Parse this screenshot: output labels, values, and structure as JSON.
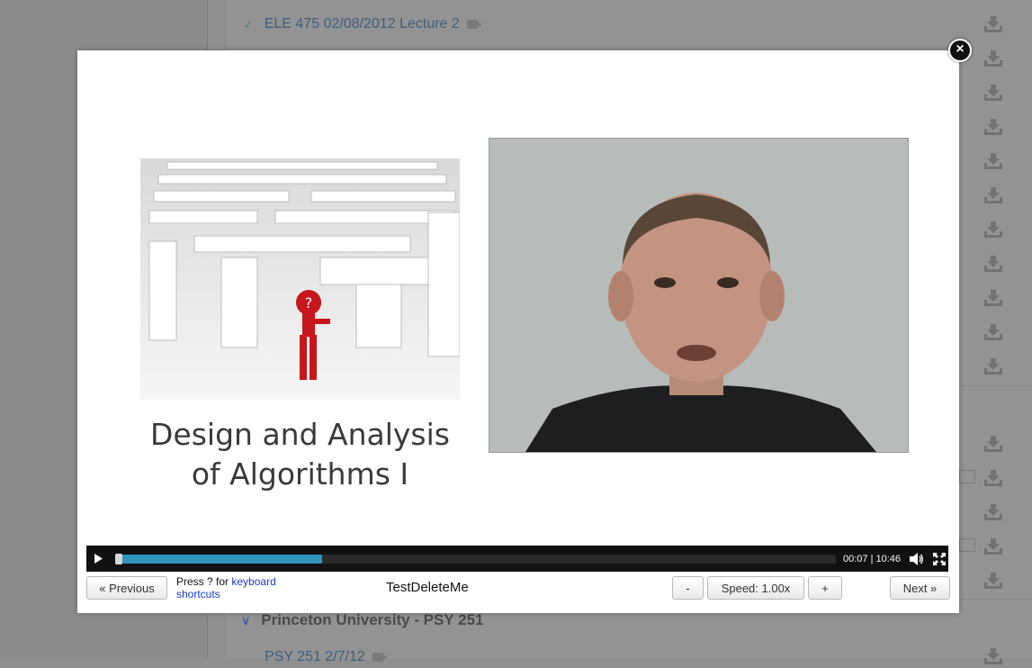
{
  "background": {
    "top_row": {
      "title": "ELE 475 02/08/2012 Lecture 2"
    },
    "section": {
      "title": "Princeton University - PSY 251"
    },
    "bottom_row": {
      "title": "PSY 251 2/7/12"
    }
  },
  "modal": {
    "close_label": "×",
    "slide_title_line1": "Design and Analysis",
    "slide_title_line2": "of Algorithms I",
    "player": {
      "time": "00:07 | 10:46",
      "progress_fraction": 0.287,
      "buffer_fraction": 0.287
    },
    "nav": {
      "previous_label": "« Previous",
      "hint_prefix": "Press ? for",
      "hint_link_line1": "keyboard",
      "hint_link_line2": "shortcuts",
      "video_title": "TestDeleteMe",
      "speed_down_label": "-",
      "speed_label": "Speed: 1.00x",
      "speed_up_label": "+",
      "next_label": "Next »"
    }
  },
  "colors": {
    "progress_fill": "#2f93bb",
    "link": "#1a3ccc"
  }
}
